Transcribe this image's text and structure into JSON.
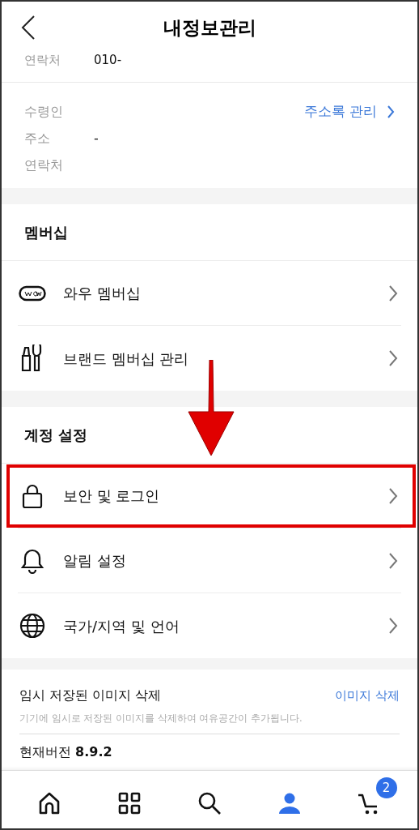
{
  "header": {
    "title": "내정보관리"
  },
  "contact_partial": {
    "label": "연락처",
    "value": "010-"
  },
  "recipient": {
    "fields": [
      {
        "label": "수령인"
      },
      {
        "label": "주소",
        "value": "-"
      },
      {
        "label": "연락처"
      }
    ],
    "link": "주소록 관리"
  },
  "sections": [
    {
      "title": "멤버십",
      "items": [
        {
          "label": "와우 멤버십",
          "highlighted": false
        },
        {
          "label": "브랜드 멤버십 관리",
          "highlighted": false
        }
      ]
    },
    {
      "title": "계정 설정",
      "items": [
        {
          "label": "보안 및 로그인",
          "highlighted": true
        },
        {
          "label": "알림 설정",
          "highlighted": false
        },
        {
          "label": "국가/지역 및 언어",
          "highlighted": false
        }
      ]
    }
  ],
  "cache": {
    "title": "임시 저장된 이미지 삭제",
    "action": "이미지 삭제",
    "description": "기기에 임시로 저장된 이미지를 삭제하여 여유공간이 추가됩니다."
  },
  "version": {
    "label": "현재버전",
    "value": "8.9.2"
  },
  "nav": [
    {
      "selected": false
    },
    {
      "selected": false
    },
    {
      "selected": false
    },
    {
      "selected": true
    },
    {
      "selected": false,
      "badge": "2"
    }
  ]
}
